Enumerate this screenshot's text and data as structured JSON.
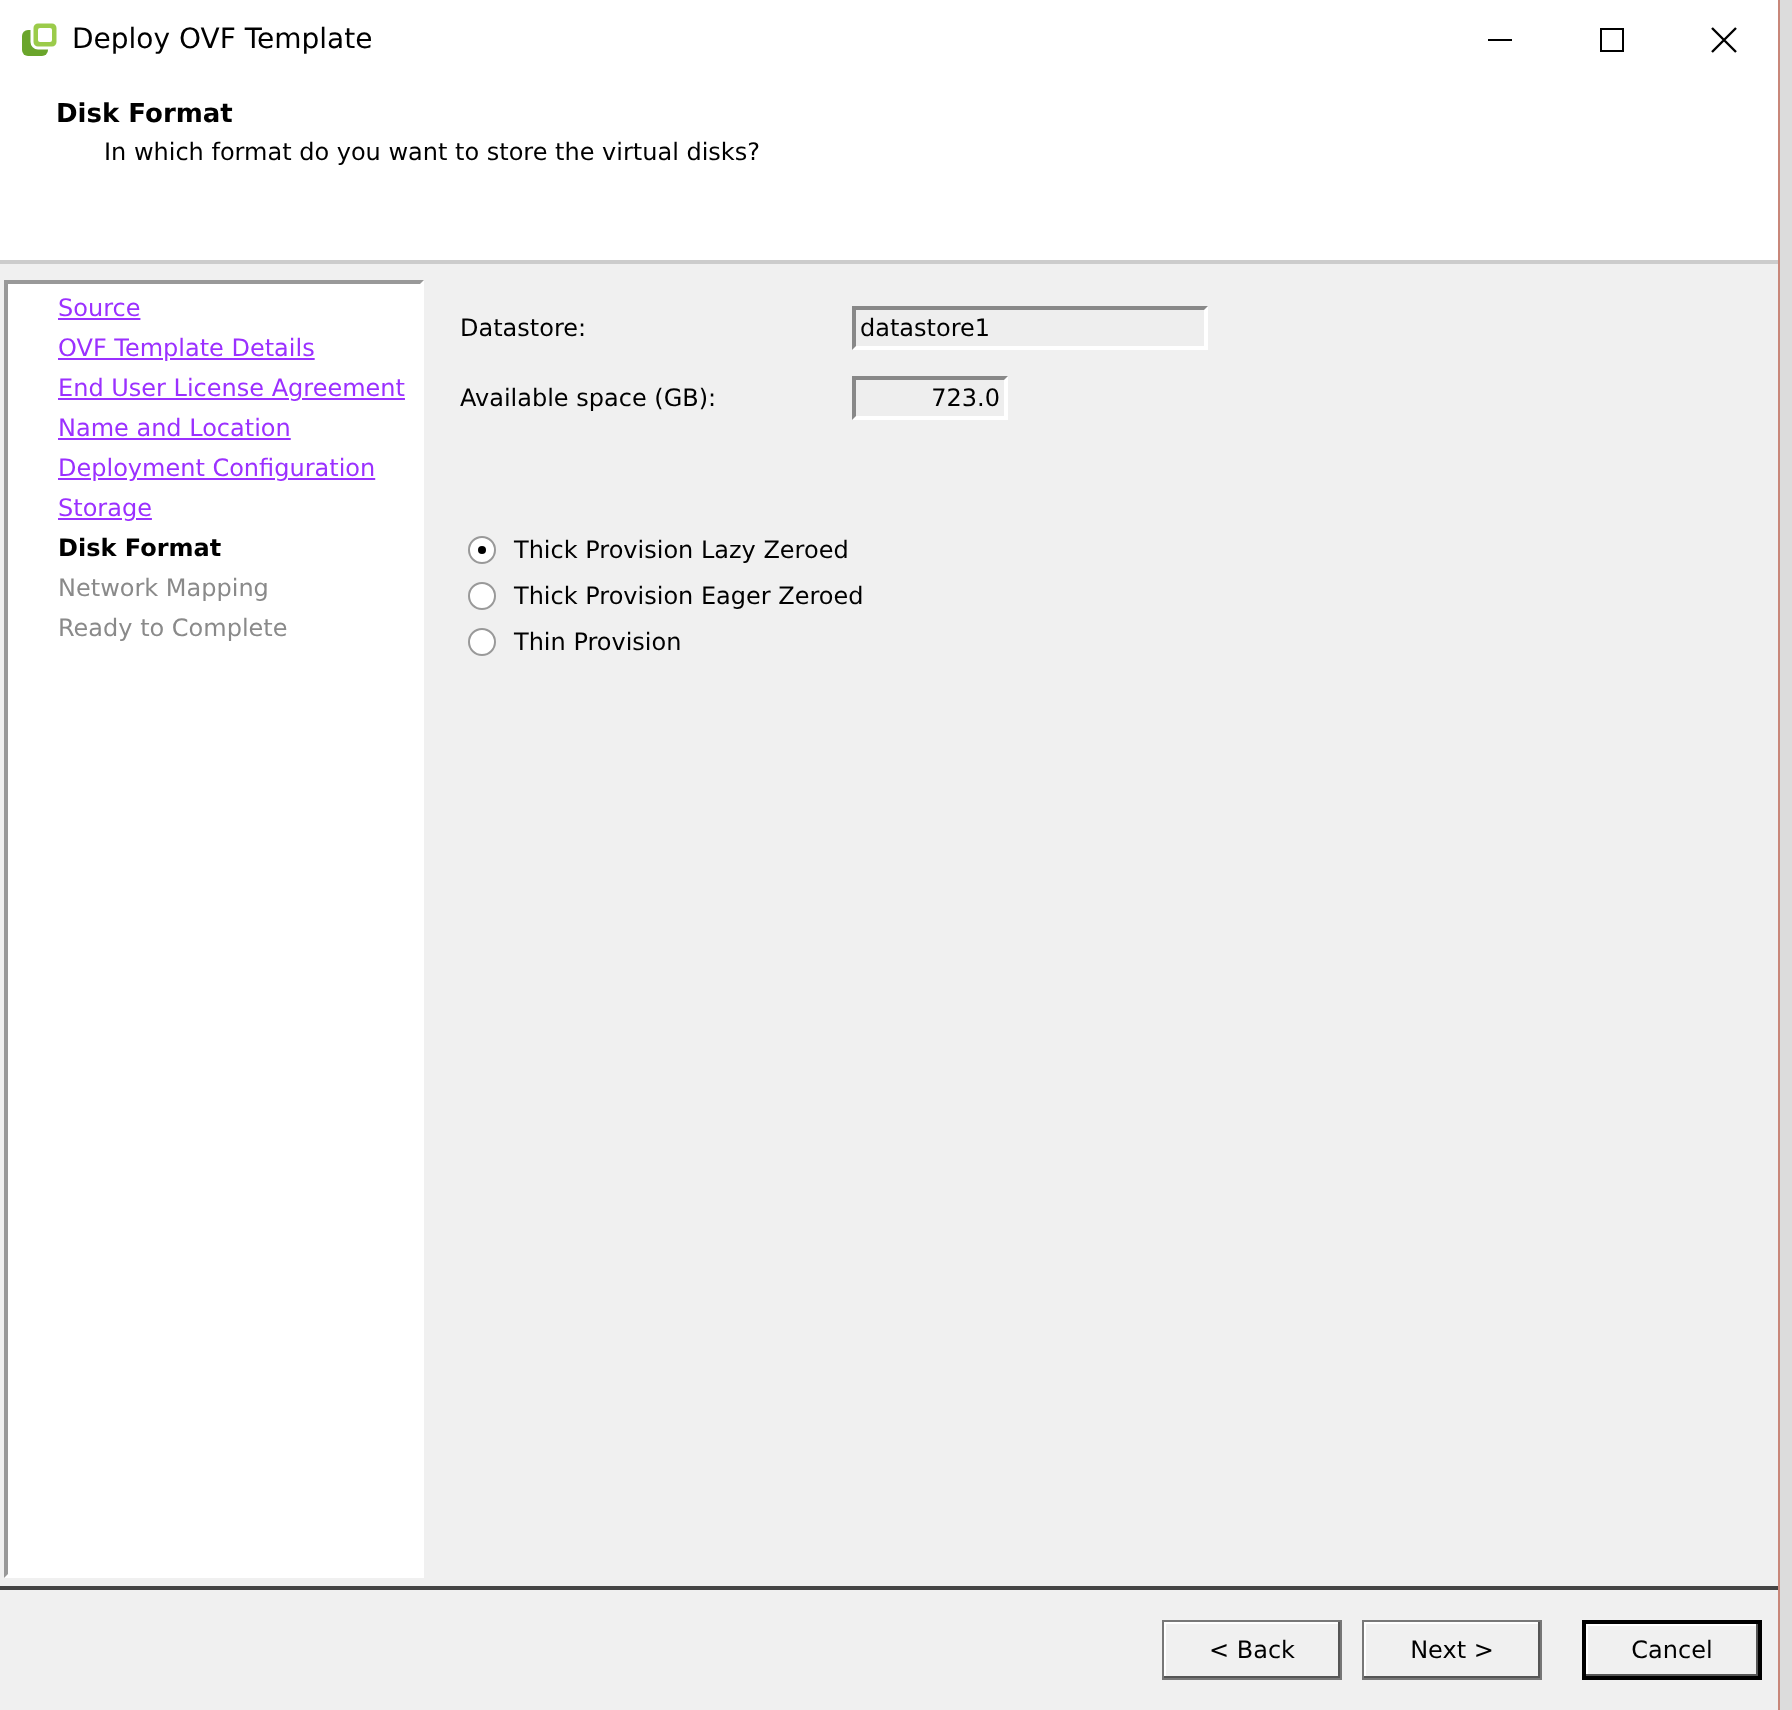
{
  "window": {
    "title": "Deploy OVF Template"
  },
  "header": {
    "title": "Disk Format",
    "subtitle": "In which format do you want to store the virtual disks?"
  },
  "steps": [
    {
      "label": "Source",
      "kind": "done"
    },
    {
      "label": "OVF Template Details",
      "kind": "done"
    },
    {
      "label": "End User License Agreement",
      "kind": "done"
    },
    {
      "label": "Name and Location",
      "kind": "done"
    },
    {
      "label": "Deployment Configuration",
      "kind": "done"
    },
    {
      "label": "Storage",
      "kind": "done"
    },
    {
      "label": "Disk Format",
      "kind": "current"
    },
    {
      "label": "Network Mapping",
      "kind": "pending"
    },
    {
      "label": "Ready to Complete",
      "kind": "pending"
    }
  ],
  "fields": [
    {
      "label": "Datastore:",
      "value": "datastore1",
      "kind": "wide"
    },
    {
      "label": "Available space (GB):",
      "value": "723.0",
      "kind": "number"
    }
  ],
  "options": [
    {
      "label": "Thick Provision Lazy Zeroed",
      "selected": true
    },
    {
      "label": "Thick Provision Eager Zeroed",
      "selected": false
    },
    {
      "label": "Thin Provision",
      "selected": false
    }
  ],
  "buttons": [
    {
      "label": "< Back",
      "kind": "normal"
    },
    {
      "label": "Next >",
      "kind": "normal"
    },
    {
      "label": "Cancel",
      "kind": "default"
    }
  ]
}
